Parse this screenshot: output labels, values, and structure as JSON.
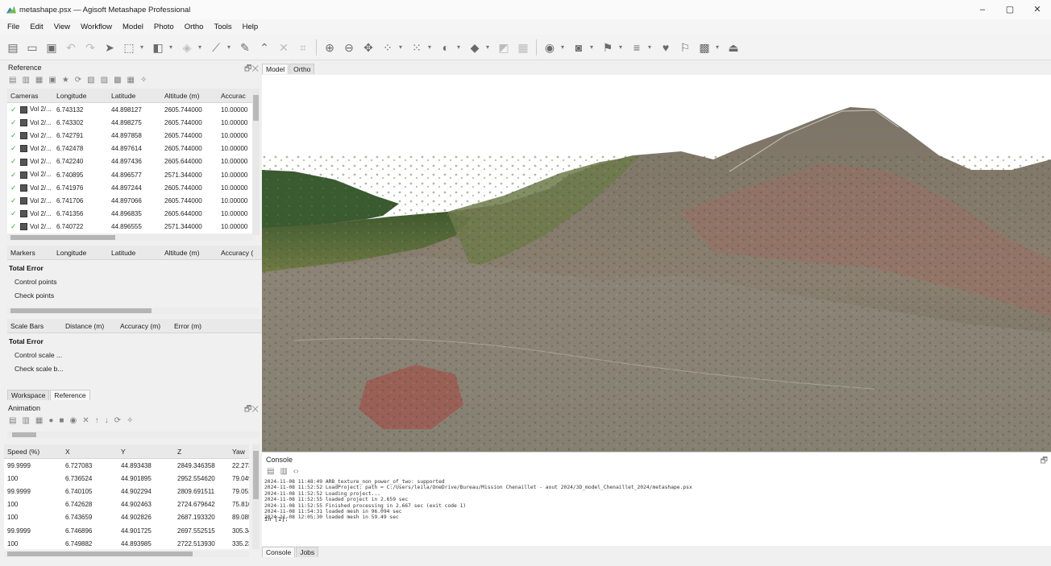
{
  "window": {
    "title": "metashape.psx — Agisoft Metashape Professional",
    "controls": [
      "–",
      "▢",
      "✕"
    ]
  },
  "menu": [
    "File",
    "Edit",
    "View",
    "Workflow",
    "Model",
    "Photo",
    "Ortho",
    "Tools",
    "Help"
  ],
  "reference": {
    "title": "Reference",
    "cameras": {
      "headers": [
        "Cameras",
        "Longitude",
        "Latitude",
        "Altitude (m)",
        "Accurac"
      ],
      "rows": [
        [
          "Vol 2/...",
          "6.743132",
          "44.898127",
          "2605.744000",
          "10.00000"
        ],
        [
          "Vol 2/...",
          "6.743302",
          "44.898275",
          "2605.744000",
          "10.00000"
        ],
        [
          "Vol 2/...",
          "6.742791",
          "44.897858",
          "2605.744000",
          "10.00000"
        ],
        [
          "Vol 2/...",
          "6.742478",
          "44.897614",
          "2605.744000",
          "10.00000"
        ],
        [
          "Vol 2/...",
          "6.742240",
          "44.897436",
          "2605.644000",
          "10.00000"
        ],
        [
          "Vol 2/...",
          "6.740895",
          "44.896577",
          "2571.344000",
          "10.00000"
        ],
        [
          "Vol 2/...",
          "6.741976",
          "44.897244",
          "2605.744000",
          "10.00000"
        ],
        [
          "Vol 2/...",
          "6.741706",
          "44.897066",
          "2605.744000",
          "10.00000"
        ],
        [
          "Vol 2/...",
          "6.741356",
          "44.896835",
          "2605.644000",
          "10.00000"
        ],
        [
          "Vol 2/...",
          "6.740722",
          "44.896555",
          "2571.344000",
          "10.00000"
        ]
      ]
    },
    "markers": {
      "headers": [
        "Markers",
        "Longitude",
        "Latitude",
        "Altitude (m)",
        "Accuracy ("
      ],
      "total": "Total Error",
      "items": [
        "Control points",
        "Check points"
      ]
    },
    "scalebars": {
      "headers": [
        "Scale Bars",
        "Distance (m)",
        "Accuracy (m)",
        "Error (m)"
      ],
      "total": "Total Error",
      "items": [
        "Control scale ...",
        "Check scale b..."
      ]
    }
  },
  "paneltabs": [
    "Workspace",
    "Reference"
  ],
  "animation": {
    "title": "Animation",
    "headers": [
      "Speed (%)",
      "X",
      "Y",
      "Z",
      "Yaw"
    ],
    "rows": [
      [
        "99.9999",
        "6.727083",
        "44.893438",
        "2849.346358",
        "22.273"
      ],
      [
        "100",
        "6.736524",
        "44.901895",
        "2952.554620",
        "79.049"
      ],
      [
        "99.9999",
        "6.740105",
        "44.902294",
        "2809.691511",
        "79.051"
      ],
      [
        "100",
        "6.742628",
        "44.902463",
        "2724.679642",
        "75.810"
      ],
      [
        "100",
        "6.743659",
        "44.902826",
        "2687.193320",
        "89.085"
      ],
      [
        "99.9999",
        "6.746896",
        "44.901725",
        "2697.552515",
        "305.347"
      ],
      [
        "100",
        "6.749882",
        "44.893985",
        "2722.513930",
        "335.232"
      ]
    ]
  },
  "viewtabs": [
    "Model",
    "Ortho"
  ],
  "console": {
    "title": "Console",
    "lines": [
      "2024-11-08 11:48:49 ARB_texture_non_power_of_two: supported",
      "2024-11-08 11:52:52 LoadProject: path = C:/Users/leila/OneDrive/Bureau/Mission Chenaillet - aout 2024/3D_model_Chenaillet_2024/metashape.psx",
      "2024-11-08 11:52:52 Loading project...",
      "2024-11-08 11:52:55 loaded project in 2.659 sec",
      "2024-11-08 11:52:55 Finished processing in 2.667 sec (exit code 1)",
      "2024-11-08 11:54:31 loaded mesh in 96.094 sec",
      "2024-11-08 12:05:30 loaded mesh in 59.49 sec"
    ],
    "prompt": "In [1]:",
    "tabs": [
      "Console",
      "Jobs"
    ]
  },
  "colors": {
    "sky": "#ffffff",
    "rock": "#8f8577",
    "vegetation": "#5a6b3e",
    "check": "#3aa83a"
  }
}
